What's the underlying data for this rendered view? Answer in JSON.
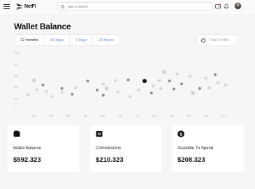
{
  "brand": {
    "name": "NetFi"
  },
  "search": {
    "placeholder": "Type to search"
  },
  "page": {
    "title": "Wallet Balance"
  },
  "tabs": [
    {
      "label": "12 months",
      "active": true
    },
    {
      "label": "30 days",
      "active": false
    },
    {
      "label": "7 days",
      "active": false
    },
    {
      "label": "24 hours",
      "active": false
    }
  ],
  "filter": {
    "label": "Total Profits"
  },
  "chart_data": {
    "type": "scatter",
    "title": "",
    "xlabel": "",
    "ylabel": "",
    "categories": [
      "Jan",
      "Feb",
      "Mar",
      "Apr",
      "May",
      "Jun",
      "Jul",
      "Aug",
      "Sep",
      "Oct",
      "Nov",
      "Dec"
    ],
    "y_ticks": [
      "0",
      "20k",
      "40k",
      "60k",
      "80k",
      "100k"
    ],
    "ylim": [
      0,
      100
    ],
    "grid": false,
    "points": [
      {
        "x": 0.1,
        "y": 27,
        "size": 2,
        "tone": "light"
      },
      {
        "x": 0.45,
        "y": 52,
        "size": 3,
        "tone": "light"
      },
      {
        "x": 0.6,
        "y": 36,
        "size": 2,
        "tone": "light"
      },
      {
        "x": 0.95,
        "y": 44,
        "size": 2,
        "tone": "dark"
      },
      {
        "x": 1.15,
        "y": 33,
        "size": 2,
        "tone": "light"
      },
      {
        "x": 1.45,
        "y": 24,
        "size": 2,
        "tone": "light"
      },
      {
        "x": 2.05,
        "y": 38,
        "size": 2,
        "tone": "dark"
      },
      {
        "x": 2.05,
        "y": 31,
        "size": 2,
        "tone": "light"
      },
      {
        "x": 2.85,
        "y": 39,
        "size": 2,
        "tone": "light"
      },
      {
        "x": 2.65,
        "y": 28,
        "size": 2,
        "tone": "dark"
      },
      {
        "x": 3.55,
        "y": 51,
        "size": 2,
        "tone": "dark"
      },
      {
        "x": 4.45,
        "y": 46,
        "size": 2,
        "tone": "light"
      },
      {
        "x": 4.1,
        "y": 35,
        "size": 2,
        "tone": "dark"
      },
      {
        "x": 4.65,
        "y": 38,
        "size": 3,
        "tone": "light"
      },
      {
        "x": 4.45,
        "y": 26,
        "size": 2,
        "tone": "dark"
      },
      {
        "x": 5.15,
        "y": 52,
        "size": 2,
        "tone": "light"
      },
      {
        "x": 5.3,
        "y": 32,
        "size": 2,
        "tone": "light"
      },
      {
        "x": 5.9,
        "y": 53,
        "size": 2,
        "tone": "dark"
      },
      {
        "x": 6.0,
        "y": 24,
        "size": 2,
        "tone": "light"
      },
      {
        "x": 6.5,
        "y": 35,
        "size": 2,
        "tone": "light"
      },
      {
        "x": 6.85,
        "y": 51,
        "size": 3,
        "tone": "black"
      },
      {
        "x": 7.35,
        "y": 42,
        "size": 2,
        "tone": "light"
      },
      {
        "x": 7.25,
        "y": 30,
        "size": 2,
        "tone": "dark"
      },
      {
        "x": 7.7,
        "y": 52,
        "size": 2,
        "tone": "light"
      },
      {
        "x": 7.8,
        "y": 38,
        "size": 2,
        "tone": "light"
      },
      {
        "x": 8.0,
        "y": 67,
        "size": 3,
        "tone": "light"
      },
      {
        "x": 8.3,
        "y": 51,
        "size": 2,
        "tone": "dark"
      },
      {
        "x": 8.55,
        "y": 37,
        "size": 2,
        "tone": "dark"
      },
      {
        "x": 8.75,
        "y": 63,
        "size": 2,
        "tone": "light"
      },
      {
        "x": 9.0,
        "y": 46,
        "size": 2,
        "tone": "dark"
      },
      {
        "x": 9.5,
        "y": 59,
        "size": 2,
        "tone": "light"
      },
      {
        "x": 9.65,
        "y": 30,
        "size": 3,
        "tone": "light"
      },
      {
        "x": 10.05,
        "y": 38,
        "size": 2,
        "tone": "dark"
      },
      {
        "x": 10.4,
        "y": 56,
        "size": 2,
        "tone": "light"
      },
      {
        "x": 10.6,
        "y": 39,
        "size": 2,
        "tone": "light"
      },
      {
        "x": 10.95,
        "y": 62,
        "size": 2,
        "tone": "dark"
      },
      {
        "x": 11.1,
        "y": 48,
        "size": 2,
        "tone": "light"
      },
      {
        "x": 11.55,
        "y": 44,
        "size": 2,
        "tone": "light"
      }
    ],
    "colors": {
      "light": "#d4d4d6",
      "dark": "#8e8e92",
      "black": "#111111"
    }
  },
  "cards": [
    {
      "label": "Wallet Balance",
      "value": "$592.323",
      "icon": "wallet-icon"
    },
    {
      "label": "Commissions",
      "value": "$210.323",
      "icon": "cash-icon"
    },
    {
      "label": "Available To Spend",
      "value": "$208.323",
      "icon": "dollar-coin-icon"
    }
  ]
}
